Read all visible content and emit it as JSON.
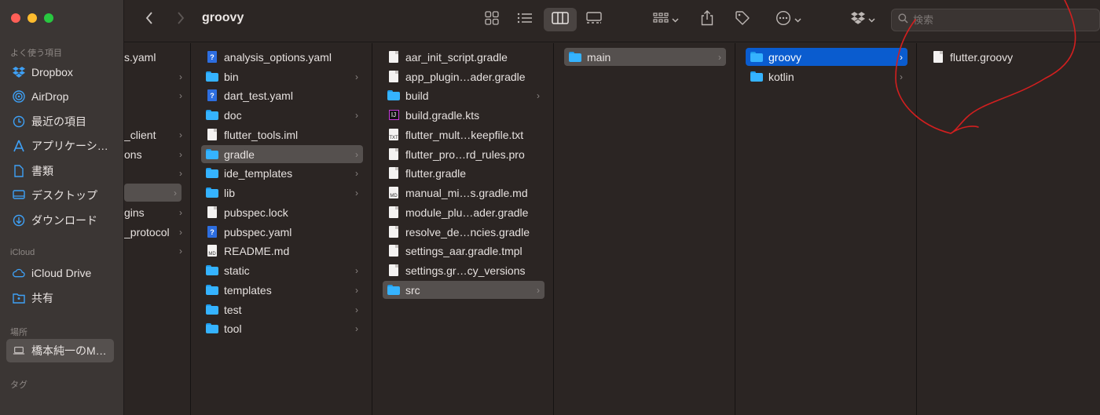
{
  "toolbar": {
    "title": "groovy",
    "search_placeholder": "検索"
  },
  "sidebar": {
    "favorites_label": "よく使う項目",
    "favorites": [
      "Dropbox",
      "AirDrop",
      "最近の項目",
      "アプリケーシ…",
      "書類",
      "デスクトップ",
      "ダウンロード"
    ],
    "icloud_label": "iCloud",
    "icloud": [
      "iCloud Drive",
      "共有"
    ],
    "locations_label": "場所",
    "locations": [
      "橋本純一のM…"
    ],
    "tags_label": "タグ"
  },
  "columns": {
    "col0": [
      {
        "name": "s.yaml",
        "kind": "file"
      },
      {
        "name": "",
        "kind": "folder"
      },
      {
        "name": "",
        "kind": "folder"
      },
      {
        "name": "_client",
        "kind": "folder"
      },
      {
        "name": "ons",
        "kind": "folder"
      },
      {
        "name": "",
        "kind": "folder"
      },
      {
        "name": "",
        "kind": "folder",
        "selected": true
      },
      {
        "name": "gins",
        "kind": "folder"
      },
      {
        "name": "_protocol",
        "kind": "folder"
      },
      {
        "name": "",
        "kind": "folder"
      }
    ],
    "col1": [
      {
        "name": "analysis_options.yaml",
        "icon": "q"
      },
      {
        "name": "bin",
        "icon": "folder"
      },
      {
        "name": "dart_test.yaml",
        "icon": "q"
      },
      {
        "name": "doc",
        "icon": "folder"
      },
      {
        "name": "flutter_tools.iml",
        "icon": "doc"
      },
      {
        "name": "gradle",
        "icon": "folder",
        "selected": true
      },
      {
        "name": "ide_templates",
        "icon": "folder"
      },
      {
        "name": "lib",
        "icon": "folder"
      },
      {
        "name": "pubspec.lock",
        "icon": "doc"
      },
      {
        "name": "pubspec.yaml",
        "icon": "q"
      },
      {
        "name": "README.md",
        "icon": "md"
      },
      {
        "name": "static",
        "icon": "folder"
      },
      {
        "name": "templates",
        "icon": "folder"
      },
      {
        "name": "test",
        "icon": "folder"
      },
      {
        "name": "tool",
        "icon": "folder"
      }
    ],
    "col2": [
      {
        "name": "aar_init_script.gradle",
        "icon": "doc"
      },
      {
        "name": "app_plugin…ader.gradle",
        "icon": "doc"
      },
      {
        "name": "build",
        "icon": "folder"
      },
      {
        "name": "build.gradle.kts",
        "icon": "ij"
      },
      {
        "name": "flutter_mult…keepfile.txt",
        "icon": "md"
      },
      {
        "name": "flutter_pro…rd_rules.pro",
        "icon": "doc"
      },
      {
        "name": "flutter.gradle",
        "icon": "doc"
      },
      {
        "name": "manual_mi…s.gradle.md",
        "icon": "md"
      },
      {
        "name": "module_plu…ader.gradle",
        "icon": "doc"
      },
      {
        "name": "resolve_de…ncies.gradle",
        "icon": "doc"
      },
      {
        "name": "settings_aar.gradle.tmpl",
        "icon": "doc"
      },
      {
        "name": "settings.gr…cy_versions",
        "icon": "doc"
      },
      {
        "name": "src",
        "icon": "folder",
        "selected": true
      }
    ],
    "col3": [
      {
        "name": "main",
        "icon": "folder",
        "selected": true
      }
    ],
    "col4": [
      {
        "name": "groovy",
        "icon": "folder",
        "selected": true
      },
      {
        "name": "kotlin",
        "icon": "folder"
      }
    ],
    "col5": [
      {
        "name": "flutter.groovy",
        "icon": "doc"
      }
    ]
  }
}
